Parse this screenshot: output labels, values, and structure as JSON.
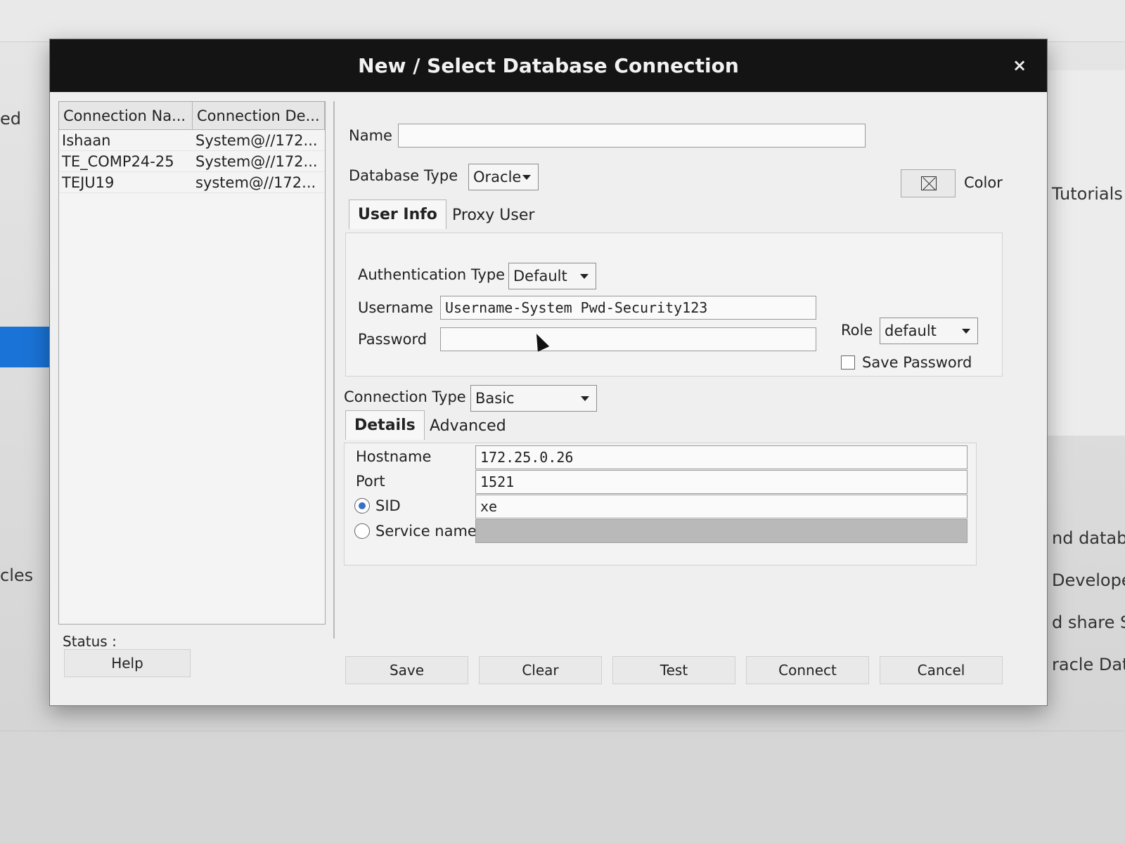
{
  "background": {
    "left_texts": [
      "ed",
      "cles"
    ],
    "right_texts": [
      "Tutorials",
      "nd database c",
      "Developer in a",
      "d share SQL, fo",
      "racle Database"
    ]
  },
  "dialog": {
    "title": "New / Select Database Connection",
    "close_symbol": "×",
    "connections": {
      "headers": [
        "Connection Na...",
        "Connection De..."
      ],
      "rows": [
        {
          "name": "Ishaan",
          "desc": "System@//172..."
        },
        {
          "name": "TE_COMP24-25",
          "desc": "System@//172..."
        },
        {
          "name": "TEJU19",
          "desc": "system@//172..."
        }
      ]
    },
    "status_label": "Status :",
    "name_label": "Name",
    "name_value": "",
    "db_type_label": "Database Type",
    "db_type_value": "Oracle",
    "color_label": "Color",
    "tabs": [
      "User Info",
      "Proxy User"
    ],
    "auth_type_label": "Authentication Type",
    "auth_type_value": "Default",
    "username_label": "Username",
    "username_value": "Username-System Pwd-Security123",
    "password_label": "Password",
    "password_value": "",
    "role_label": "Role",
    "role_value": "default",
    "save_password_label": "Save Password",
    "connection_type_label": "Connection Type",
    "connection_type_value": "Basic",
    "sub_tabs": [
      "Details",
      "Advanced"
    ],
    "hostname_label": "Hostname",
    "hostname_value": "172.25.0.26",
    "port_label": "Port",
    "port_value": "1521",
    "sid_label": "SID",
    "sid_value": "xe",
    "service_name_label": "Service name",
    "service_name_value": "",
    "buttons": {
      "help": "Help",
      "save": "Save",
      "clear": "Clear",
      "test": "Test",
      "connect": "Connect",
      "cancel": "Cancel"
    }
  }
}
